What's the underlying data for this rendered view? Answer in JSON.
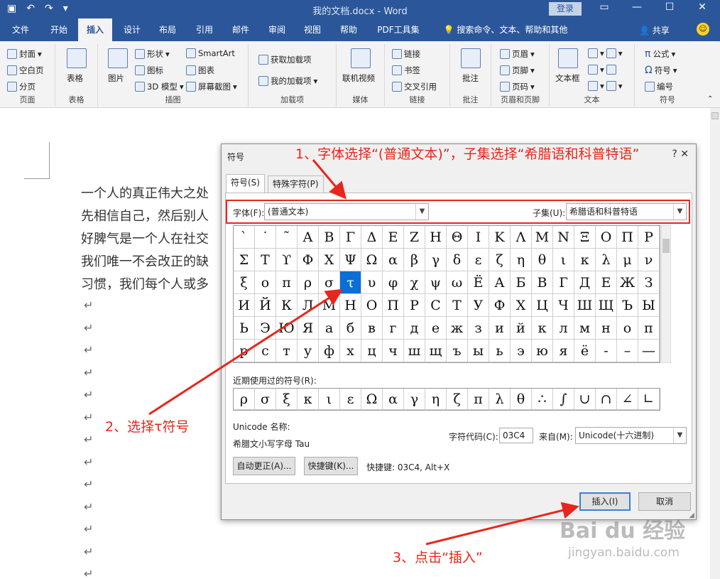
{
  "window": {
    "title": "我的文档.docx  -  Word",
    "login": "登录"
  },
  "tabs": [
    "文件",
    "开始",
    "插入",
    "设计",
    "布局",
    "引用",
    "邮件",
    "审阅",
    "视图",
    "帮助",
    "PDF工具集"
  ],
  "search_tab": "搜索命令、文本、帮助和其他",
  "share": "共享",
  "ribbon": {
    "groups": {
      "pages": "页面",
      "tables": "表格",
      "illustrations": "插图",
      "addins": "加载项",
      "media": "媒体",
      "links": "链接",
      "comments": "批注",
      "headerfooter": "页眉和页脚",
      "text": "文本",
      "symbols": "符号"
    },
    "pages": [
      "封面",
      "空白页",
      "分页"
    ],
    "table": "表格",
    "picture": "图片",
    "illus": [
      "形状",
      "图标",
      "3D 模型"
    ],
    "illus2": [
      "SmartArt",
      "图表",
      "屏幕截图"
    ],
    "addins": [
      "获取加载项",
      "我的加载项"
    ],
    "video": "联机视频",
    "links": [
      "链接",
      "书签",
      "交叉引用"
    ],
    "comment": "批注",
    "hf": [
      "页眉",
      "页脚",
      "页码"
    ],
    "textbox": "文本框",
    "symbols": [
      "公式",
      "符号",
      "编号"
    ]
  },
  "doc": {
    "lines": [
      "一个人的真正伟大之处",
      "先相信自己，然后别人",
      "好脾气是一个人在社交",
      "我们唯一不会改正的缺",
      "习惯，我们每个人或多"
    ],
    "para_mark": "↵"
  },
  "dialog": {
    "title": "符号",
    "tabs": [
      "符号(S)",
      "特殊字符(P)"
    ],
    "font_label": "字体(F):",
    "font_value": "(普通文本)",
    "subset_label": "子集(U):",
    "subset_value": "希腊语和科普特语",
    "symbols": [
      "`",
      "˙",
      "˜",
      "Α",
      "Β",
      "Γ",
      "Δ",
      "Ε",
      "Ζ",
      "Η",
      "Θ",
      "Ι",
      "Κ",
      "Λ",
      "Μ",
      "Ν",
      "Ξ",
      "Ο",
      "Π",
      "Ρ",
      "Σ",
      "Τ",
      "ϒ",
      "Φ",
      "Χ",
      "Ψ",
      "Ω",
      "α",
      "β",
      "γ",
      "δ",
      "ε",
      "ζ",
      "η",
      "θ",
      "ι",
      "κ",
      "λ",
      "μ",
      "ν",
      "ξ",
      "ο",
      "π",
      "ρ",
      "σ",
      "τ",
      "υ",
      "φ",
      "χ",
      "ψ",
      "ω",
      "Ё",
      "А",
      "Б",
      "В",
      "Г",
      "Д",
      "Е",
      "Ж",
      "З",
      "И",
      "Й",
      "К",
      "Л",
      "М",
      "Н",
      "О",
      "П",
      "Р",
      "С",
      "Т",
      "У",
      "Ф",
      "Х",
      "Ц",
      "Ч",
      "Ш",
      "Щ",
      "Ъ",
      "Ы",
      "Ь",
      "Э",
      "Ю",
      "Я",
      "а",
      "б",
      "в",
      "г",
      "д",
      "е",
      "ж",
      "з",
      "и",
      "й",
      "к",
      "л",
      "м",
      "н",
      "о",
      "п",
      "р",
      "с",
      "т",
      "у",
      "ф",
      "х",
      "ц",
      "ч",
      "ш",
      "щ",
      "ъ",
      "ы",
      "ь",
      "э",
      "ю",
      "я",
      "ё",
      "-",
      "–",
      "—"
    ],
    "selected_index": 45,
    "recent_label": "近期使用过的符号(R):",
    "recent": [
      "ρ",
      "σ",
      "ξ",
      "κ",
      "ι",
      "ε",
      "Ω",
      "α",
      "γ",
      "η",
      "ζ",
      "π",
      "λ",
      "θ",
      "∴",
      "∫",
      "∪",
      "∩",
      "∠",
      "∟"
    ],
    "unicode_name_label": "Unicode 名称:",
    "unicode_name": "希腊文小写字母 Tau",
    "char_code_label": "字符代码(C):",
    "char_code": "03C4",
    "from_label": "来自(M):",
    "from_value": "Unicode(十六进制)",
    "autocorrect_btn": "自动更正(A)...",
    "shortcut_btn": "快捷键(K)...",
    "shortcut_text": "快捷键: 03C4, Alt+X",
    "insert_btn": "插入(I)",
    "cancel_btn": "取消"
  },
  "annotations": {
    "step1": "1、字体选择“(普通文本)”，子集选择“希腊语和科普特语”",
    "step2": "2、选择τ符号",
    "step3": "3、点击“插入”"
  },
  "watermark": {
    "brand": "Bai du 经验",
    "url": "jingyan.baidu.com"
  },
  "colors": {
    "ribbon_blue": "#2b579a",
    "annotation_red": "#e8261c",
    "selected_cell": "#0a6fd6"
  }
}
